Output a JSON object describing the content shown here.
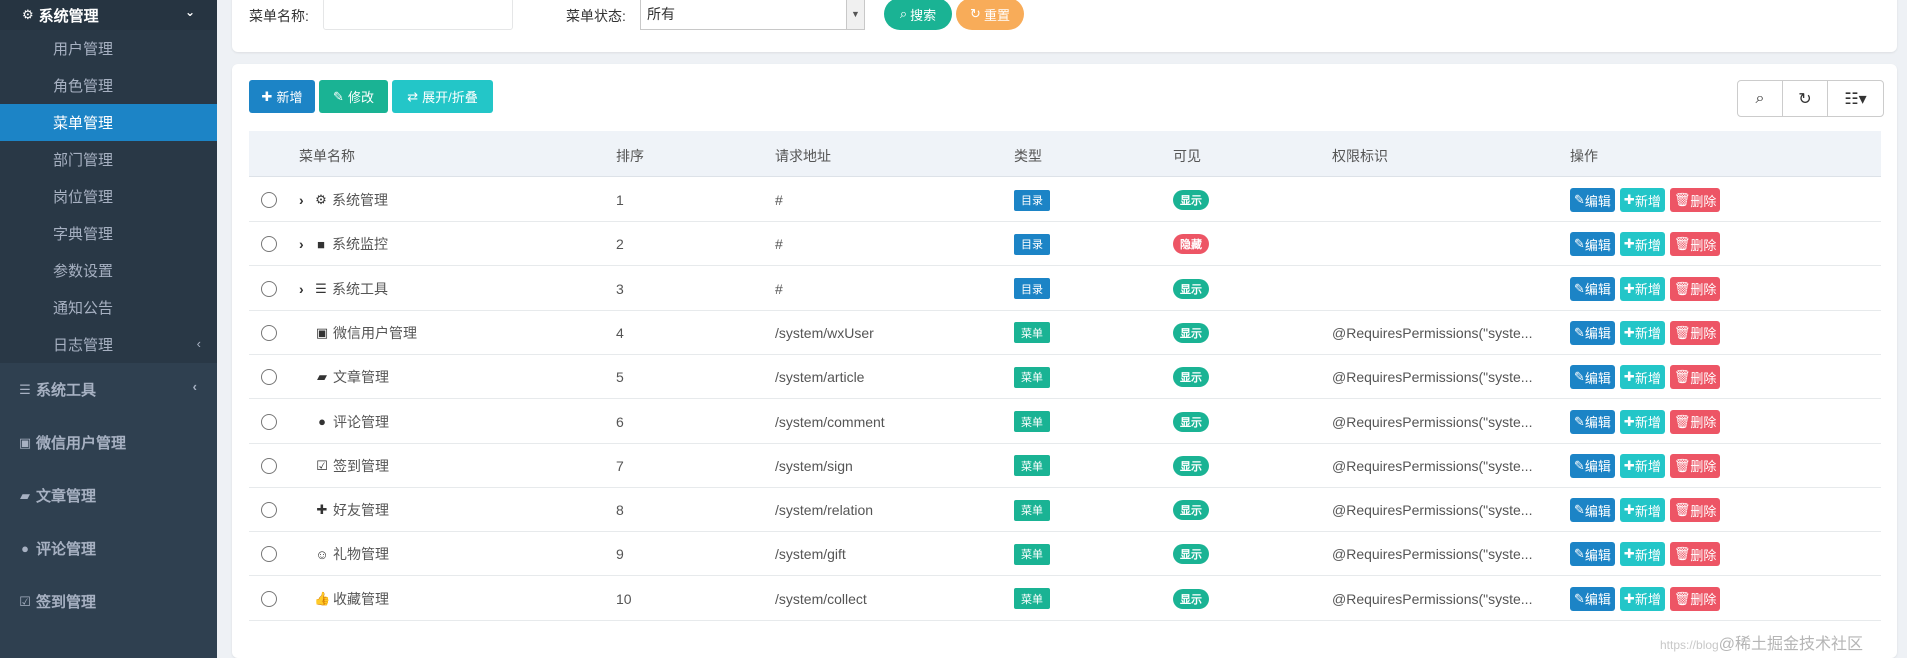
{
  "sidebar": {
    "top_label": "系统管理",
    "sub_items": [
      {
        "label": "用户管理"
      },
      {
        "label": "角色管理"
      },
      {
        "label": "菜单管理"
      },
      {
        "label": "部门管理"
      },
      {
        "label": "岗位管理"
      },
      {
        "label": "字典管理"
      },
      {
        "label": "参数设置"
      },
      {
        "label": "通知公告"
      },
      {
        "label": "日志管理"
      }
    ],
    "top_items": [
      {
        "label": "系统工具"
      },
      {
        "label": "微信用户管理"
      },
      {
        "label": "文章管理"
      },
      {
        "label": "评论管理"
      },
      {
        "label": "签到管理"
      }
    ]
  },
  "search": {
    "name_label": "菜单名称:",
    "name_value": "",
    "status_label": "菜单状态:",
    "status_value": "所有",
    "search_button": "搜索",
    "reset_button": "重置"
  },
  "toolbar": {
    "add": "新增",
    "edit": "修改",
    "expand": "展开/折叠"
  },
  "table": {
    "headers": {
      "name": "菜单名称",
      "order": "排序",
      "url": "请求地址",
      "type": "类型",
      "visible": "可见",
      "perms": "权限标识",
      "ops": "操作"
    },
    "rows": [
      {
        "name": "系统管理",
        "order": "1",
        "url": "#",
        "type": "目录",
        "visible": "显示",
        "perms": ""
      },
      {
        "name": "系统监控",
        "order": "2",
        "url": "#",
        "type": "目录",
        "visible": "隐藏",
        "perms": ""
      },
      {
        "name": "系统工具",
        "order": "3",
        "url": "#",
        "type": "目录",
        "visible": "显示",
        "perms": ""
      },
      {
        "name": "微信用户管理",
        "order": "4",
        "url": "/system/wxUser",
        "type": "菜单",
        "visible": "显示",
        "perms": "@RequiresPermissions(\"syste..."
      },
      {
        "name": "文章管理",
        "order": "5",
        "url": "/system/article",
        "type": "菜单",
        "visible": "显示",
        "perms": "@RequiresPermissions(\"syste..."
      },
      {
        "name": "评论管理",
        "order": "6",
        "url": "/system/comment",
        "type": "菜单",
        "visible": "显示",
        "perms": "@RequiresPermissions(\"syste..."
      },
      {
        "name": "签到管理",
        "order": "7",
        "url": "/system/sign",
        "type": "菜单",
        "visible": "显示",
        "perms": "@RequiresPermissions(\"syste..."
      },
      {
        "name": "好友管理",
        "order": "8",
        "url": "/system/relation",
        "type": "菜单",
        "visible": "显示",
        "perms": "@RequiresPermissions(\"syste..."
      },
      {
        "name": "礼物管理",
        "order": "9",
        "url": "/system/gift",
        "type": "菜单",
        "visible": "显示",
        "perms": "@RequiresPermissions(\"syste..."
      },
      {
        "name": "收藏管理",
        "order": "10",
        "url": "/system/collect",
        "type": "菜单",
        "visible": "显示",
        "perms": "@RequiresPermissions(\"syste..."
      }
    ],
    "actions": {
      "edit": "编辑",
      "add": "新增",
      "delete": "删除"
    }
  },
  "watermark": {
    "prefix": "https://blog",
    "text": "@稀土掘金技术社区"
  },
  "colors": {
    "sidebar_bg": "#2f4050",
    "active": "#1c84c6",
    "primary": "#1c84c6",
    "success": "#1ab394",
    "info": "#23c6c8",
    "danger": "#ed5565",
    "warning": "#f8ac59"
  }
}
